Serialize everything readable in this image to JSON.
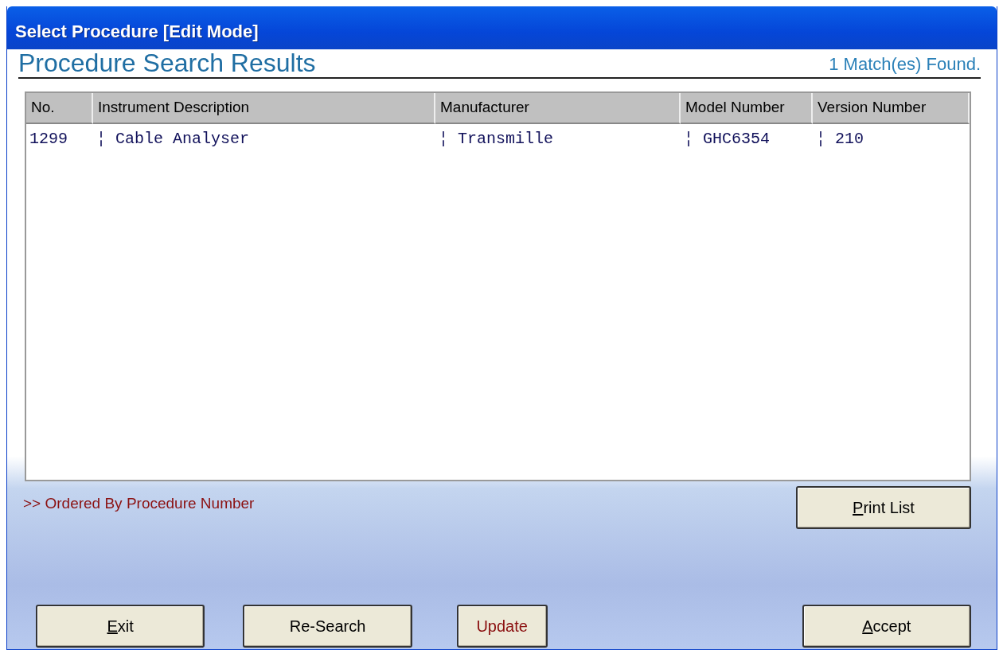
{
  "window": {
    "title": "Select Procedure [Edit Mode]"
  },
  "heading": "Procedure Search Results",
  "match_count": "1 Match(es) Found.",
  "table": {
    "columns": [
      "No.",
      "Instrument Description",
      "Manufacturer",
      "Model Number",
      "Version Number"
    ],
    "rows": [
      {
        "selected": false,
        "cells": [
          "1299",
          "¦ Cable Analyser",
          "¦ Transmille",
          "¦ GHC6354",
          "¦ 210"
        ]
      }
    ]
  },
  "order_note": ">> Ordered By Procedure Number",
  "print_button": {
    "access_key": "P",
    "after": "rint List"
  },
  "buttons": [
    {
      "kind": "normal",
      "access_key": "E",
      "after": "xit"
    },
    {
      "kind": "normal",
      "before": "Re-Search"
    },
    {
      "kind": "warning",
      "before": "Update"
    },
    {
      "kind": "normal",
      "access_key": "A",
      "after": "ccept"
    }
  ]
}
